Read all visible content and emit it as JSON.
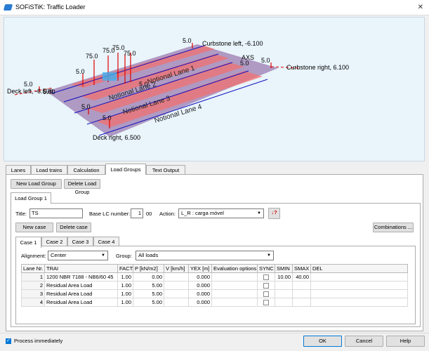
{
  "window": {
    "title": "SOFiSTiK: Traffic Loader",
    "close_glyph": "✕"
  },
  "viewport": {
    "labels": {
      "curbstone_left": "Curbstone left, -6.100",
      "curbstone_right": "Curbstone right, 6.100",
      "deck_left": "Deck left, -6.500",
      "deck_right": "Deck right, 6.500",
      "axis": "AXS",
      "lanes": [
        "Notional Lane 1",
        "Notional Lane 2",
        "Notional Lane 3",
        "Notional Lane 4"
      ],
      "load_small": "5.0",
      "load_big": "75.0",
      "deck_left_num": "6.00"
    },
    "colors": {
      "deck": "#a58ab8",
      "lane_red": "#f07070",
      "lane_blue": "#1010c0",
      "load_red": "#e00000"
    }
  },
  "main_tabs": [
    "Lanes",
    "Load trains",
    "Calculation",
    "Load Groups",
    "Text Output"
  ],
  "active_main_tab": 3,
  "load_groups": {
    "new_button": "New Load Group",
    "delete_button": "Delete Load Group",
    "group_tab": "Load Group 1",
    "title_label": "Title:",
    "title_value": "TS",
    "base_lc_label": "Base LC number:",
    "base_lc_value": "1",
    "base_lc_suffix": "00",
    "action_label": "Action:",
    "action_value": "L_R   : carga móvel",
    "action_icon_text": "↓?",
    "new_case_button": "New case",
    "delete_case_button": "Delete case",
    "combinations_button": "Combinations ...",
    "case_tabs": [
      "Case 1",
      "Case 2",
      "Case 3",
      "Case 4"
    ],
    "alignment_label": "Alignment:",
    "alignment_value": "Center",
    "group_label": "Group:",
    "group_value": "All loads",
    "table": {
      "headers": [
        "Lane Nr.",
        "TRAI",
        "FACT",
        "P [kN/m2]",
        "V [km/h]",
        "YEX [m]",
        "Evaluation options",
        "SYNC",
        "SMIN",
        "SMAX",
        "DEL"
      ],
      "rows": [
        {
          "nr": "1",
          "trai": "1200 NBR 7188 - NB6/60 45",
          "fact": "1.00",
          "p": "0.00",
          "v": "",
          "yex": "0.000",
          "eval": "",
          "smin": "10.00",
          "smax": "40.00",
          "del": ""
        },
        {
          "nr": "2",
          "trai": "Residual Area Load",
          "fact": "1.00",
          "p": "5.00",
          "v": "",
          "yex": "0.000",
          "eval": "",
          "smin": "",
          "smax": "",
          "del": ""
        },
        {
          "nr": "3",
          "trai": "Residual Area Load",
          "fact": "1.00",
          "p": "5.00",
          "v": "",
          "yex": "0.000",
          "eval": "",
          "smin": "",
          "smax": "",
          "del": ""
        },
        {
          "nr": "4",
          "trai": "Residual Area Load",
          "fact": "1.00",
          "p": "5.00",
          "v": "",
          "yex": "0.000",
          "eval": "",
          "smin": "",
          "smax": "",
          "del": ""
        }
      ]
    }
  },
  "footer": {
    "process_label": "Process immediately",
    "ok_button": "OK",
    "cancel_button": "Cancel",
    "help_button": "Help"
  }
}
